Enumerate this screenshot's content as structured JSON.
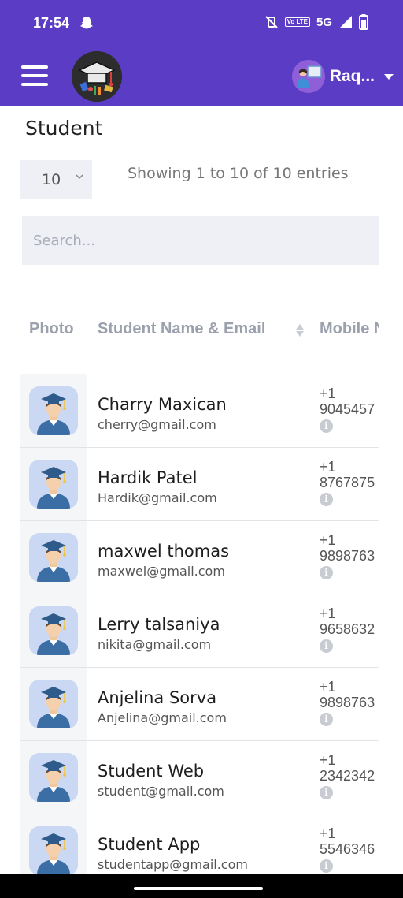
{
  "status": {
    "time": "17:54",
    "volte": "Vo LTE",
    "network": "5G"
  },
  "app": {
    "user_name": "Raq..."
  },
  "page": {
    "title": "Student",
    "page_size": "10",
    "entries_info": "Showing 1 to 10 of 10 entries",
    "search_placeholder": "Search..."
  },
  "table": {
    "headers": {
      "photo": "Photo",
      "name_email": "Student Name & Email",
      "mobile": "Mobile N"
    },
    "rows": [
      {
        "name": "Charry Maxican",
        "email": "cherry@gmail.com",
        "country_code": "+1",
        "phone": "9045457"
      },
      {
        "name": "Hardik Patel",
        "email": "Hardik@gmail.com",
        "country_code": "+1",
        "phone": "8767875"
      },
      {
        "name": "maxwel thomas",
        "email": "maxwel@gmail.com",
        "country_code": "+1",
        "phone": "9898763"
      },
      {
        "name": "Lerry talsaniya",
        "email": "nikita@gmail.com",
        "country_code": "+1",
        "phone": "9658632"
      },
      {
        "name": "Anjelina Sorva",
        "email": "Anjelina@gmail.com",
        "country_code": "+1",
        "phone": "9898763"
      },
      {
        "name": "Student Web",
        "email": "student@gmail.com",
        "country_code": "+1",
        "phone": "2342342"
      },
      {
        "name": "Student App",
        "email": "studentapp@gmail.com",
        "country_code": "+1",
        "phone": "5546346"
      }
    ]
  },
  "colors": {
    "primary": "#5b3cc4",
    "field_bg": "#eef0f6",
    "avatar_bg": "#cad8f4"
  }
}
